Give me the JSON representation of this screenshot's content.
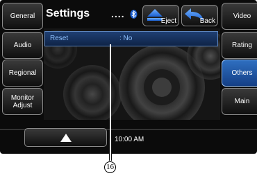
{
  "header": {
    "title": "Settings",
    "dots": "...."
  },
  "left_buttons": [
    {
      "label": "General"
    },
    {
      "label": "Audio"
    },
    {
      "label": "Regional"
    },
    {
      "label": "Monitor\nAdjust"
    }
  ],
  "right_buttons": [
    {
      "label": "Video"
    },
    {
      "label": "Rating"
    },
    {
      "label": "Others",
      "active": true
    },
    {
      "label": "Main"
    }
  ],
  "top_buttons": {
    "eject": "Eject",
    "back": "Back"
  },
  "settings_row": {
    "key": "Reset",
    "value": ": No"
  },
  "status": {
    "time": "10:00 AM"
  },
  "icons": {
    "bluetooth": "bluetooth-icon",
    "eject": "eject-icon",
    "back": "back-arrow-icon",
    "up": "up-arrow-icon"
  },
  "colors": {
    "active": "#1f5fb0",
    "row_text": "#8fc2ff",
    "row_bg": "#16325c"
  },
  "annotation": {
    "number": "16"
  }
}
